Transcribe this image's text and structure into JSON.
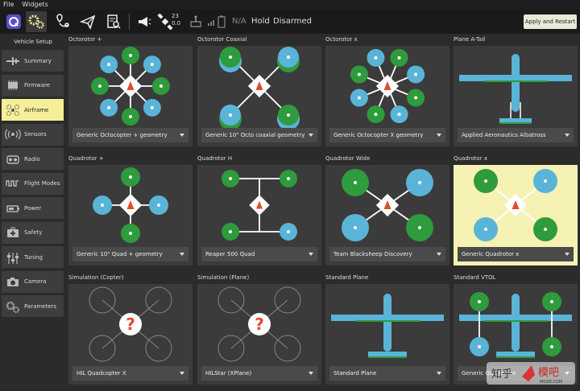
{
  "menu": {
    "file": "File",
    "widgets": "Widgets"
  },
  "toolbar": {
    "icons": [
      "logo-icon",
      "gear-icon",
      "map-pin-icon",
      "paper-plane-icon",
      "checklist-icon",
      "megaphone-icon",
      "satellite-icon",
      "joystick-icon",
      "signal-icon",
      "battery-icon"
    ],
    "satellite_count": "23",
    "satellite_hdop": "0.0",
    "battery_label": "N/A",
    "flight_mode": "Hold",
    "arm_state": "Disarmed",
    "apply_label": "Apply and Restart"
  },
  "sidebar": {
    "title": "Vehicle Setup",
    "items": [
      {
        "label": "Summary",
        "icon": "plane-icon"
      },
      {
        "label": "Firmware",
        "icon": "chip-icon"
      },
      {
        "label": "Airframe",
        "icon": "airframe-icon"
      },
      {
        "label": "Sensors",
        "icon": "sensor-icon"
      },
      {
        "label": "Radio",
        "icon": "radio-icon"
      },
      {
        "label": "Flight Modes",
        "icon": "wave-icon"
      },
      {
        "label": "Power",
        "icon": "battery-icon"
      },
      {
        "label": "Safety",
        "icon": "first-aid-icon"
      },
      {
        "label": "Tuning",
        "icon": "sliders-icon"
      },
      {
        "label": "Camera",
        "icon": "camera-icon"
      },
      {
        "label": "Parameters",
        "icon": "gears-icon"
      }
    ],
    "active_index": 2
  },
  "airframes": [
    {
      "title": "Octorotor +",
      "selection": "Generic Octocopter + geometry",
      "kind": "octo-plus"
    },
    {
      "title": "Octorotor Coaxial",
      "selection": "Generic 10\" Octo coaxial geometry",
      "kind": "octo-coax"
    },
    {
      "title": "Octorotor x",
      "selection": "Generic Octocopter X geometry",
      "kind": "octo-x"
    },
    {
      "title": "Plane A-Tail",
      "selection": "Applied Aeronautics Albatross",
      "kind": "plane-atail"
    },
    {
      "title": "Quadrotor +",
      "selection": "Generic 10\" Quad + geometry",
      "kind": "quad-plus"
    },
    {
      "title": "Quadrotor H",
      "selection": "Reaper 500 Quad",
      "kind": "quad-h"
    },
    {
      "title": "Quadrotor Wide",
      "selection": "Team Blacksheep Discovery",
      "kind": "quad-wide"
    },
    {
      "title": "Quadrotor x",
      "selection": "Generic Quadrotor x",
      "kind": "quad-x"
    },
    {
      "title": "Simulation (Copter)",
      "selection": "HIL Quadcopter X",
      "kind": "sim"
    },
    {
      "title": "Simulation (Plane)",
      "selection": "HILStar (XPlane)",
      "kind": "sim"
    },
    {
      "title": "Standard Plane",
      "selection": "Standard Plane",
      "kind": "plane-std"
    },
    {
      "title": "Standard VTOL",
      "selection": "Generic Quadplane",
      "kind": "vtol"
    }
  ],
  "selected_index": 7,
  "colors": {
    "green": "#2e9b3c",
    "blue": "#5ab4d8",
    "selected": "#f6f2b4",
    "active_sidebar": "#f5ef9a"
  },
  "watermark": {
    "text1": "知乎",
    "text2": "模吧",
    "url": "MOZ8.COM"
  }
}
